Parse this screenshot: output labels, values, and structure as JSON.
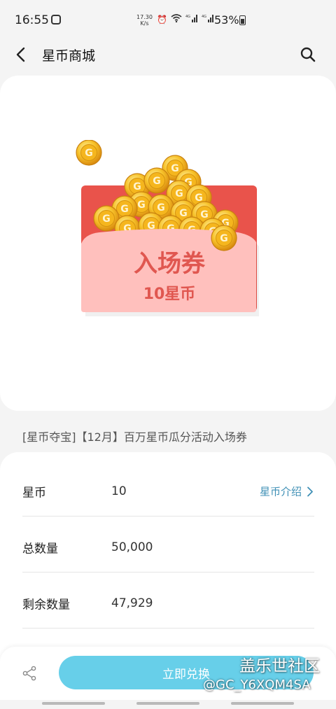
{
  "status_bar": {
    "time": "16:55",
    "net_speed_value": "17.30",
    "net_speed_unit": "K/s",
    "battery": "53%",
    "icons": [
      "alarm-icon",
      "wifi-icon",
      "signal-4g-icon",
      "signal-4g-icon",
      "battery-icon"
    ]
  },
  "header": {
    "title": "星币商城"
  },
  "product": {
    "image_caption": "入场券",
    "image_price": "10星币",
    "title": "[星币夺宝]【12月】百万星币瓜分活动入场券"
  },
  "details": {
    "rows": [
      {
        "label": "星币",
        "value": "10",
        "link": "星币介绍"
      },
      {
        "label": "总数量",
        "value": "50,000"
      },
      {
        "label": "剩余数量",
        "value": "47,929"
      }
    ]
  },
  "action_bar": {
    "redeem_label": "立即兑换"
  },
  "watermark": {
    "line1": "盖乐世社区",
    "line2": "@GC_Y6XQM4SA"
  },
  "colors": {
    "accent_button": "#67cfe9",
    "link": "#3e8fb5",
    "envelope_red": "#e9534b",
    "envelope_pink": "#ffc0bd",
    "coin_gold": "#f5b61e"
  }
}
